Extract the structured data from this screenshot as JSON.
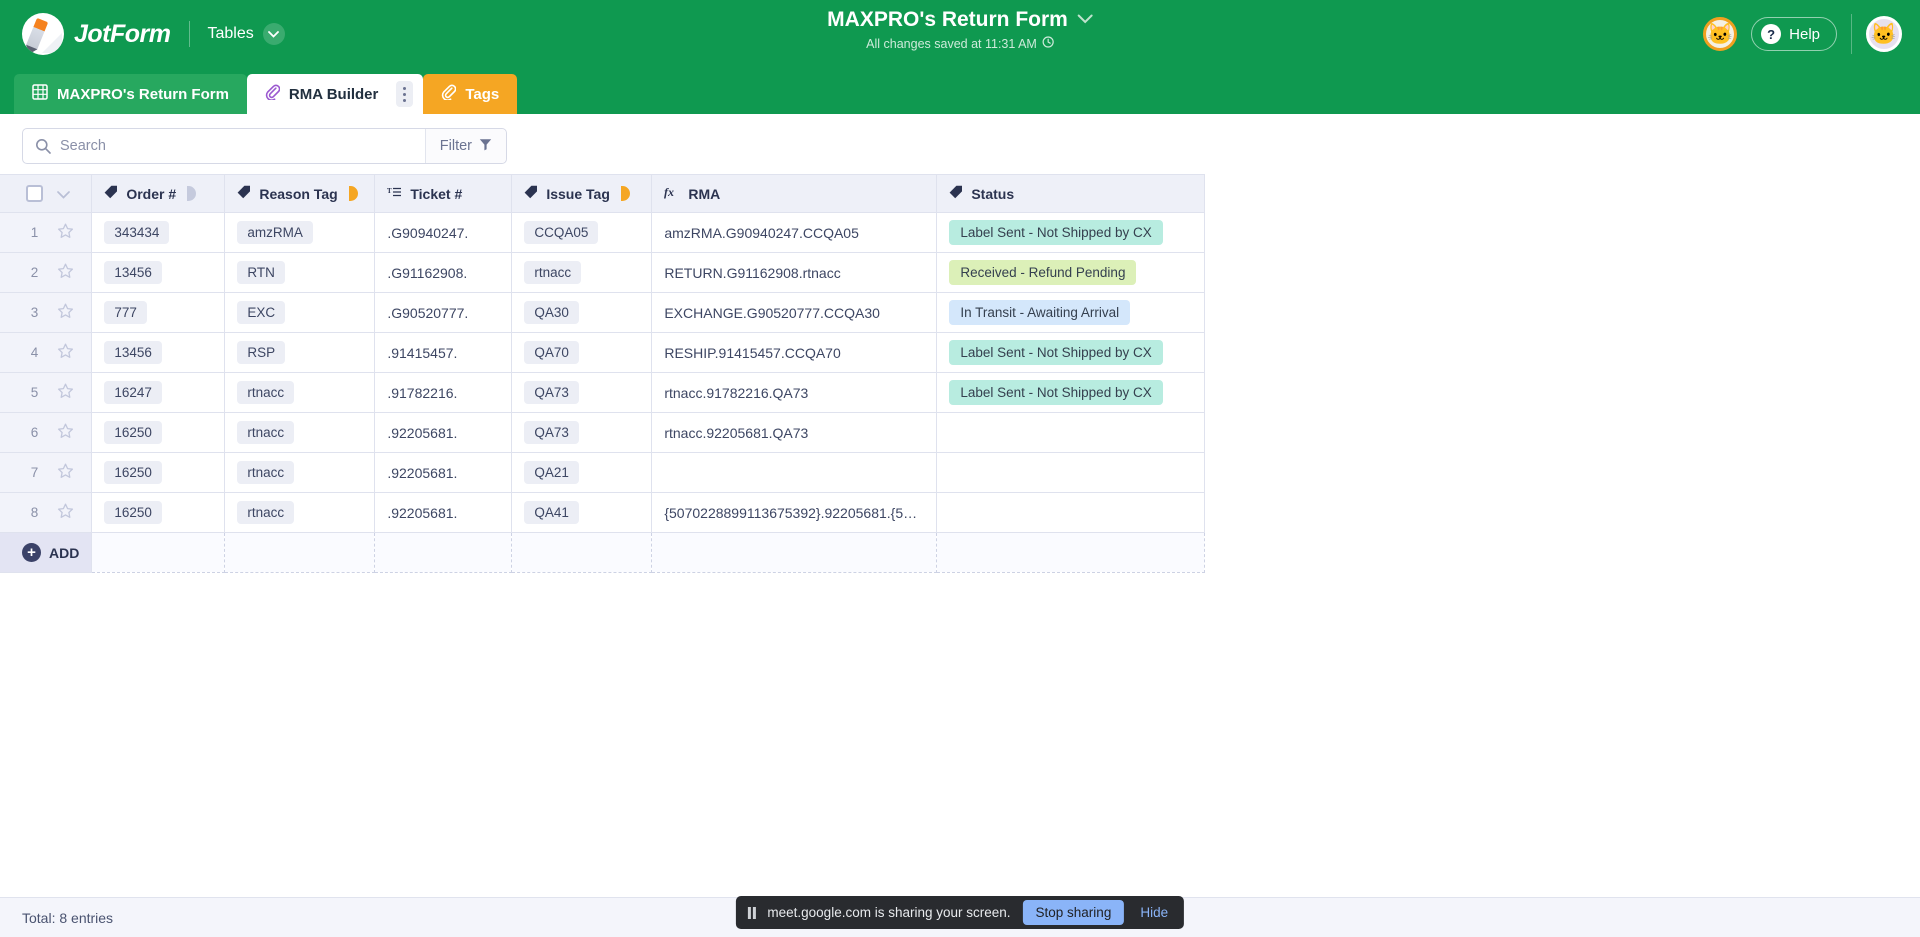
{
  "header": {
    "brand_name": "JotForm",
    "tables_label": "Tables",
    "title": "MAXPRO's Return Form",
    "saved_status": "All changes saved at 11:31 AM",
    "help_label": "Help",
    "avatar_left_icon": "cat-face-avatar",
    "avatar_right_icon": "cat-face-avatar"
  },
  "tabs": [
    {
      "label": "MAXPRO's Return Form",
      "icon": "grid-icon",
      "state": "inactive"
    },
    {
      "label": "RMA Builder",
      "icon": "paperclip-icon",
      "state": "active"
    },
    {
      "label": "Tags",
      "icon": "paperclip-icon",
      "state": "highlight"
    }
  ],
  "toolbar": {
    "search_placeholder": "Search",
    "search_value": "",
    "filter_label": "Filter"
  },
  "table": {
    "columns": [
      {
        "label": "Order #",
        "icon": "tag-icon",
        "indicator": "grey"
      },
      {
        "label": "Reason Tag",
        "icon": "tag-icon",
        "indicator": "amber"
      },
      {
        "label": "Ticket #",
        "icon": "text-icon",
        "indicator": "none"
      },
      {
        "label": "Issue Tag",
        "icon": "tag-icon",
        "indicator": "amber"
      },
      {
        "label": "RMA",
        "icon": "formula-icon",
        "indicator": "none"
      },
      {
        "label": "Status",
        "icon": "tag-icon",
        "indicator": "none"
      }
    ],
    "rows": [
      {
        "n": "1",
        "order": "343434",
        "reason": "amzRMA",
        "ticket": ".G90940247.",
        "issue": "CCQA05",
        "rma": "amzRMA.G90940247.CCQA05",
        "status": "Label Sent - Not Shipped by CX",
        "status_color": "#b8ece0"
      },
      {
        "n": "2",
        "order": "13456",
        "reason": "RTN",
        "ticket": ".G91162908.",
        "issue": "rtnacc",
        "rma": "RETURN.G91162908.rtnacc",
        "status": "Received - Refund Pending",
        "status_color": "#dcf0b8"
      },
      {
        "n": "3",
        "order": "777",
        "reason": "EXC",
        "ticket": ".G90520777.",
        "issue": "QA30",
        "rma": "EXCHANGE.G90520777.CCQA30",
        "status": "In Transit - Awaiting Arrival",
        "status_color": "#d4e7fb"
      },
      {
        "n": "4",
        "order": "13456",
        "reason": "RSP",
        "ticket": ".91415457.",
        "issue": "QA70",
        "rma": "RESHIP.91415457.CCQA70",
        "status": "Label Sent - Not Shipped by CX",
        "status_color": "#b8ece0"
      },
      {
        "n": "5",
        "order": "16247",
        "reason": "rtnacc",
        "ticket": ".91782216.",
        "issue": "QA73",
        "rma": "rtnacc.91782216.QA73",
        "status": "Label Sent - Not Shipped by CX",
        "status_color": "#b8ece0"
      },
      {
        "n": "6",
        "order": "16250",
        "reason": "rtnacc",
        "ticket": ".92205681.",
        "issue": "QA73",
        "rma": "rtnacc.92205681.QA73",
        "status": "",
        "status_color": ""
      },
      {
        "n": "7",
        "order": "16250",
        "reason": "rtnacc",
        "ticket": ".92205681.",
        "issue": "QA21",
        "rma": "",
        "status": "",
        "status_color": ""
      },
      {
        "n": "8",
        "order": "16250",
        "reason": "rtnacc",
        "ticket": ".92205681.",
        "issue": "QA41",
        "rma": "{5070228899113675392}.92205681.{5…",
        "status": "",
        "status_color": ""
      }
    ],
    "add_label": "ADD"
  },
  "footer": {
    "total_label": "Total: 8 entries"
  },
  "sharebar": {
    "message": "meet.google.com is sharing your screen.",
    "stop_label": "Stop sharing",
    "hide_label": "Hide"
  },
  "colors": {
    "brand_green": "#0f9950",
    "tab_amber": "#f5a623",
    "accent_blue": "#8ab4f8"
  }
}
